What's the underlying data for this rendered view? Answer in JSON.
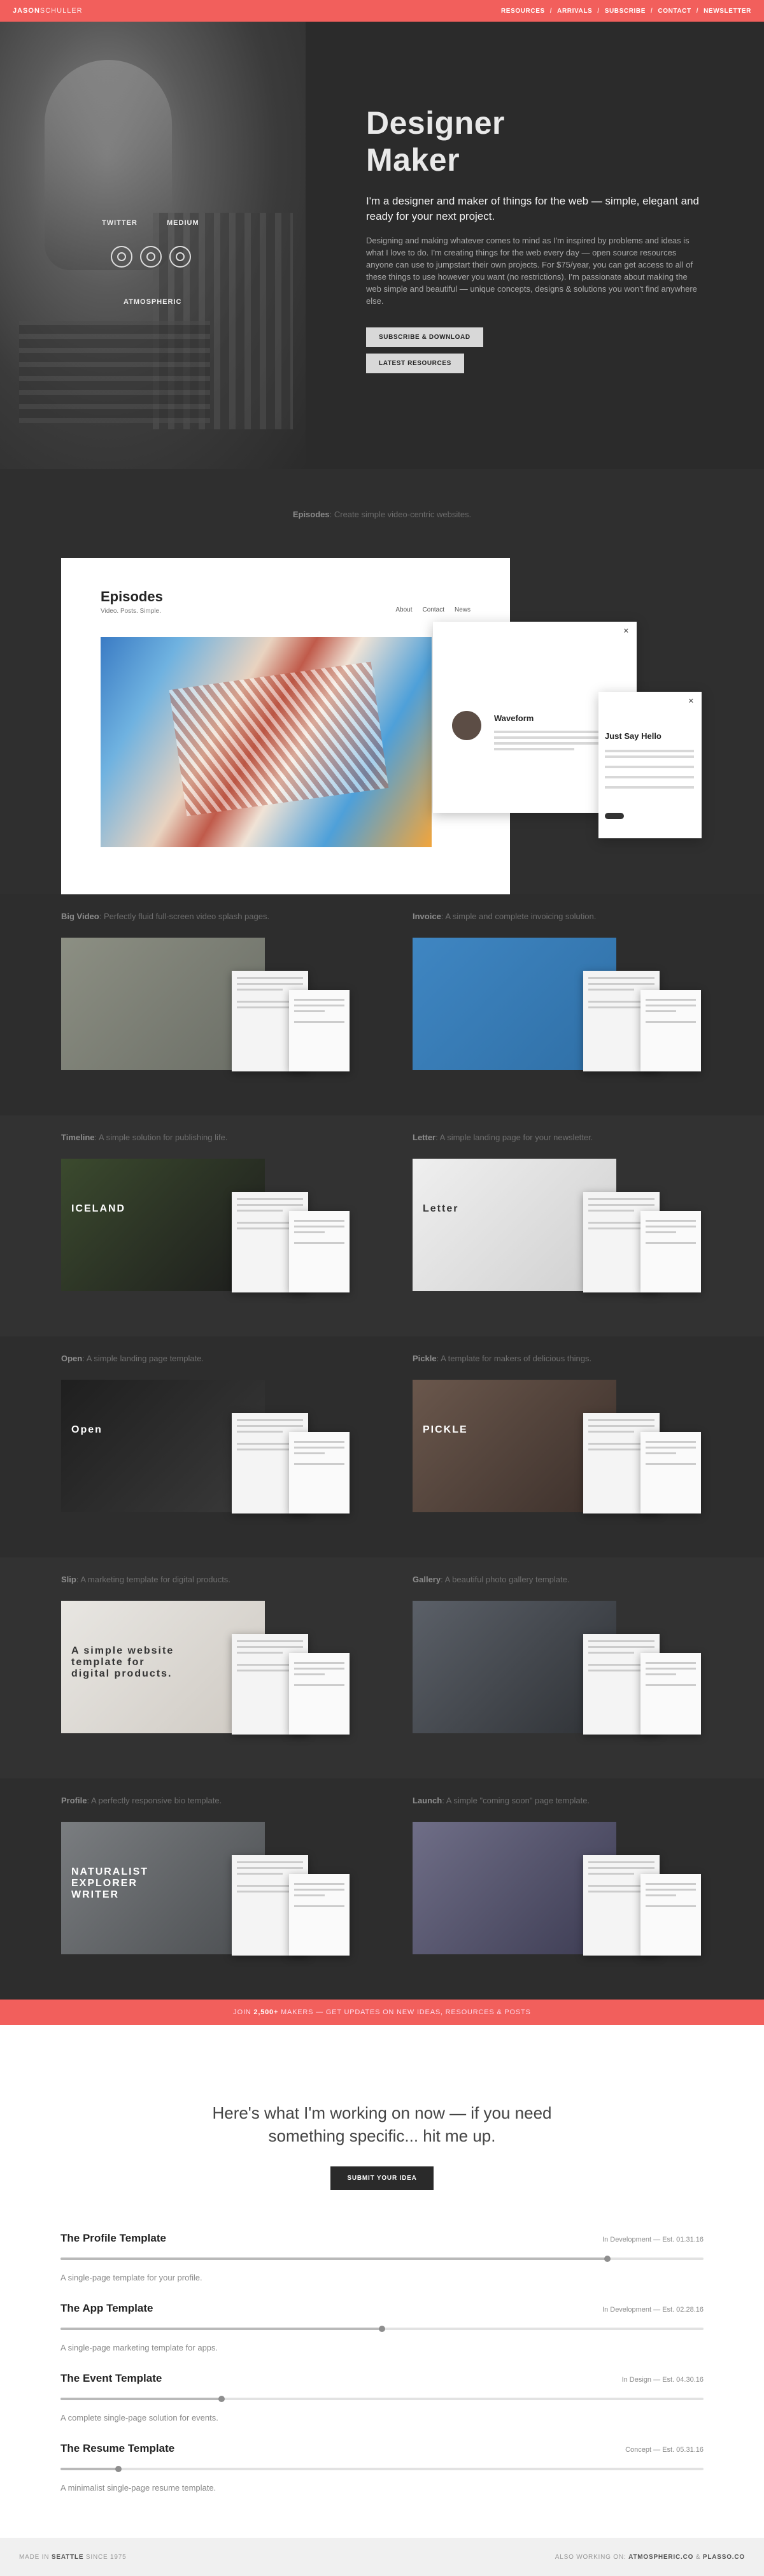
{
  "header": {
    "brand_bold": "JASON",
    "brand_light": "SCHULLER",
    "nav": [
      "RESOURCES",
      "ARRIVALS",
      "SUBSCRIBE",
      "CONTACT",
      "NEWSLETTER"
    ],
    "sep": "/"
  },
  "hero": {
    "title_line1": "Designer",
    "title_line2": "Maker",
    "lead": "I'm a designer and maker of things for the web — simple, elegant and ready for your next project.",
    "body": "Designing and making whatever comes to mind as I'm inspired by problems and ideas is what I love to do. I'm creating things for the web every day — open source resources anyone can use to jumpstart their own projects. For $75/year, you can get access to all of these things to use however you want (no restrictions). I'm passionate about making the web simple and beautiful — unique concepts, designs & solutions you won't find anywhere else.",
    "btn_subscribe": "SUBSCRIBE & DOWNLOAD",
    "btn_resources": "LATEST RESOURCES",
    "social": {
      "twitter": "TWITTER",
      "medium": "MEDIUM",
      "atmospheric": "ATMOSPHERIC"
    }
  },
  "featured": {
    "name": "Episodes",
    "caption": "Create simple video-centric websites.",
    "mock_title": "Episodes",
    "mock_sub": "Video. Posts. Simple.",
    "mock_nav": [
      "About",
      "Contact",
      "News"
    ],
    "panel_title": "Waveform",
    "panel2_title": "Just Say Hello"
  },
  "templates": [
    {
      "name": "Big Video",
      "desc": "Perfectly fluid full-screen video splash pages.",
      "colors": [
        "#8c8f83",
        "#6b6e66"
      ],
      "sub": ""
    },
    {
      "name": "Invoice",
      "desc": "A simple and complete invoicing solution.",
      "colors": [
        "#3f86c2",
        "#2f6fa6"
      ],
      "sub": ""
    },
    {
      "name": "Timeline",
      "desc": "A simple solution for publishing life.",
      "colors": [
        "#3b4a2e",
        "#1c1c1c"
      ],
      "sub": "ICELAND"
    },
    {
      "name": "Letter",
      "desc": "A simple landing page for your newsletter.",
      "colors": [
        "#efefef",
        "#cfcfcf"
      ],
      "sub": "Letter"
    },
    {
      "name": "Open",
      "desc": "A simple landing page template.",
      "colors": [
        "#1f1f1f",
        "#3a3a3a"
      ],
      "sub": "Open"
    },
    {
      "name": "Pickle",
      "desc": "A template for makers of delicious things.",
      "colors": [
        "#6a574c",
        "#3b2f2a"
      ],
      "sub": "PICKLE"
    },
    {
      "name": "Slip",
      "desc": "A marketing template for digital products.",
      "colors": [
        "#e8e6e2",
        "#cfcac3"
      ],
      "sub": "A simple website template for digital products."
    },
    {
      "name": "Gallery",
      "desc": "A beautiful photo gallery template.",
      "colors": [
        "#5b6068",
        "#2e3135"
      ],
      "sub": ""
    },
    {
      "name": "Profile",
      "desc": "A perfectly responsive bio template.",
      "colors": [
        "#7a7d80",
        "#4b4e51"
      ],
      "sub": "NATURALIST EXPLORER WRITER"
    },
    {
      "name": "Launch",
      "desc": "A simple \"coming soon\" page template.",
      "colors": [
        "#6f6e87",
        "#3c3b52"
      ],
      "sub": ""
    }
  ],
  "subscribe_band": {
    "pre": "JOIN",
    "count": "2,500+",
    "post": "MAKERS — GET UPDATES ON NEW IDEAS, RESOURCES & POSTS"
  },
  "work": {
    "heading": "Here's what I'm working on now — if you need something specific... hit me up.",
    "cta": "SUBMIT YOUR IDEA",
    "projects": [
      {
        "title": "The Profile Template",
        "status": "In Development — Est. 01.31.16",
        "desc": "A single-page template for your profile.",
        "progress": 0.85
      },
      {
        "title": "The App Template",
        "status": "In Development — Est. 02.28.16",
        "desc": "A single-page marketing template for apps.",
        "progress": 0.5
      },
      {
        "title": "The Event Template",
        "status": "In Design — Est. 04.30.16",
        "desc": "A complete single-page solution for events.",
        "progress": 0.25
      },
      {
        "title": "The Resume Template",
        "status": "Concept — Est. 05.31.16",
        "desc": "A minimalist single-page resume template.",
        "progress": 0.09
      }
    ]
  },
  "footer": {
    "left_pre": "MADE IN",
    "left_city": "SEATTLE",
    "left_post": "SINCE 1975",
    "right_pre": "ALSO WORKING ON:",
    "right_a": "ATMOSPHERIC.CO",
    "right_amp": "&",
    "right_b": "PLASSO.CO"
  }
}
